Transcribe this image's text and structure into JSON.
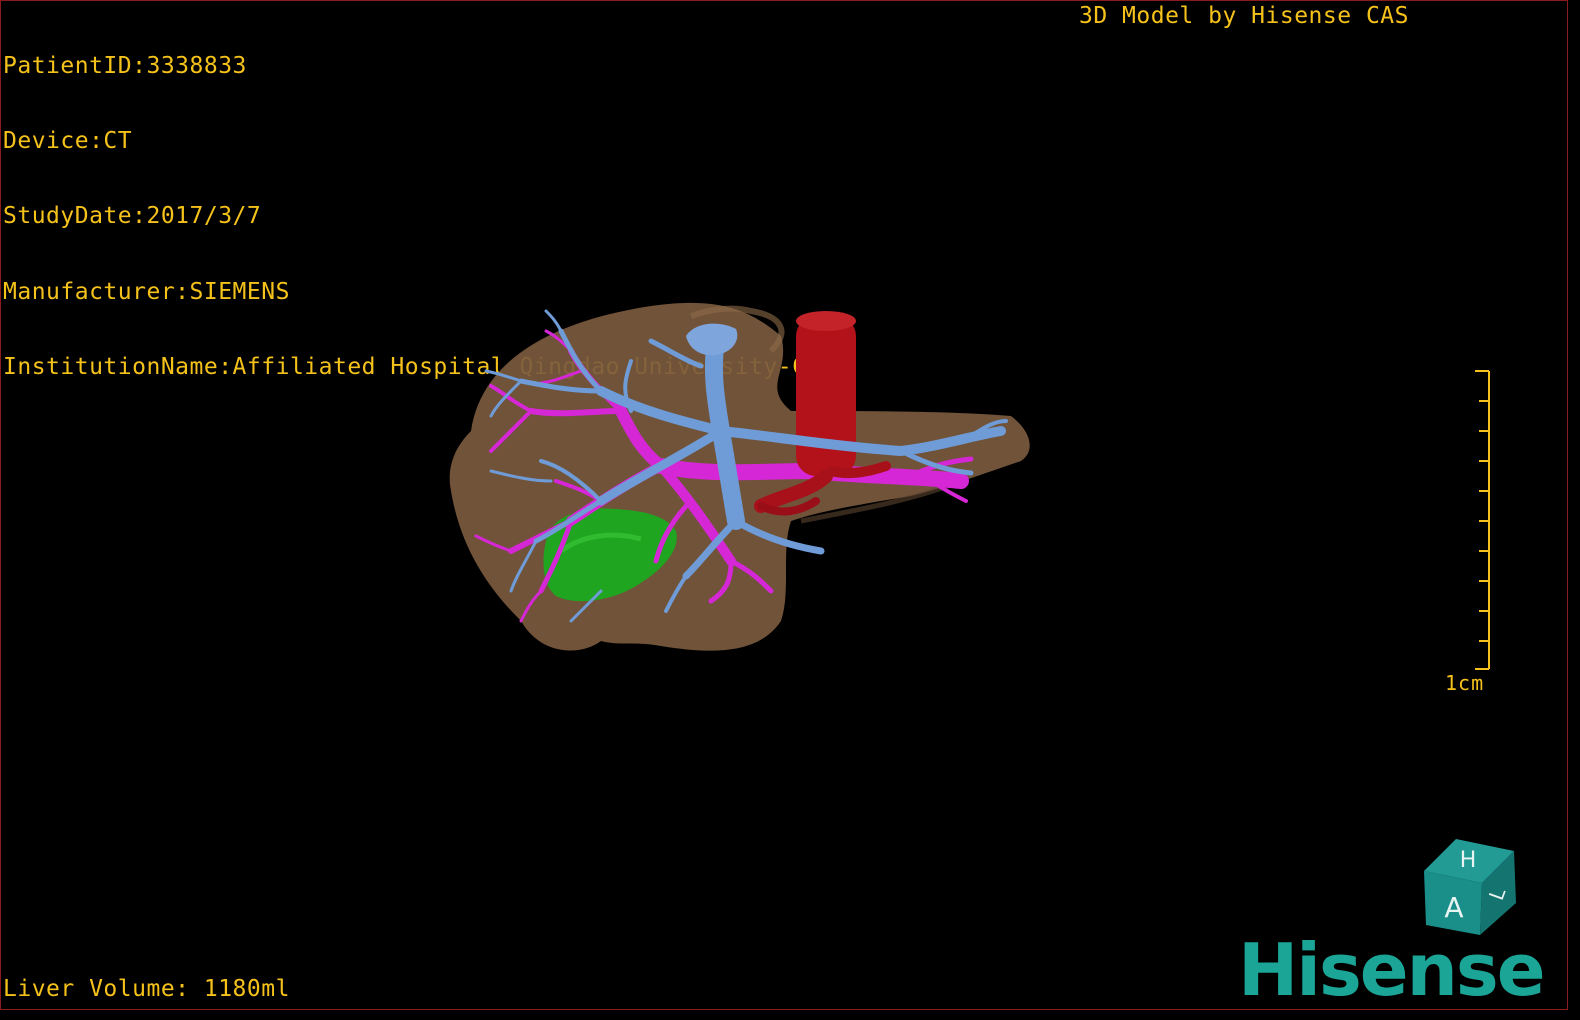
{
  "patient_info": {
    "patient_id": "PatientID:3338833",
    "device": "Device:CT",
    "study_date": "StudyDate:2017/3/7",
    "manufacturer": "Manufacturer:SIEMENS",
    "institution": "InstitutionName:Affiliated Hospital Qingdao University-C"
  },
  "model_credit": "3D Model by Hisense CAS",
  "liver_volume": "Liver Volume: 1180ml",
  "scale": {
    "label": "1cm"
  },
  "orientation_cube": {
    "top_label": "H",
    "front_label": "A",
    "side_label": "L"
  },
  "logo": {
    "text": "Hisense"
  },
  "colors": {
    "overlay_text": "#f5c21b",
    "liver": "#7a5a3e",
    "hepatic_vein": "#6f9bd6",
    "portal_vein": "#d627d6",
    "artery_ivc": "#b3121a",
    "gallbladder_tumor": "#1fa51f",
    "cube": "#1a8f8a",
    "logo": "#1aa596"
  }
}
